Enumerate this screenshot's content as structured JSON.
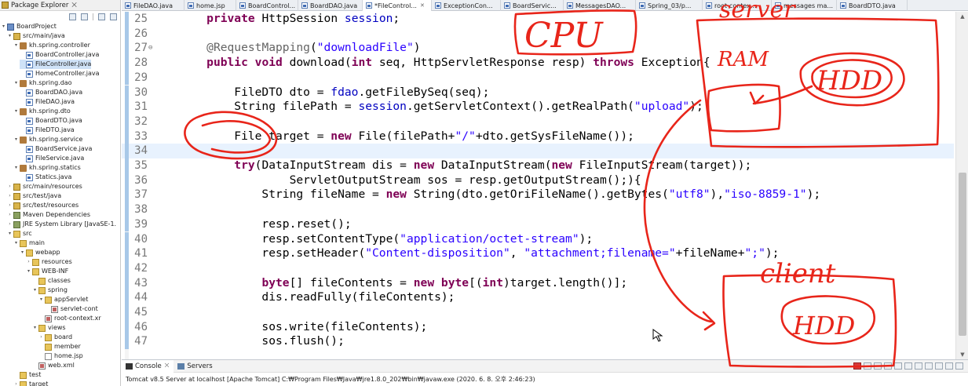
{
  "explorer": {
    "title": "Package Explorer",
    "close_glyph": "⨉",
    "tree": [
      {
        "label": "BoardProject",
        "depth": 0,
        "icon": "project",
        "expanded": true
      },
      {
        "label": "src/main/java",
        "depth": 1,
        "icon": "src",
        "expanded": true
      },
      {
        "label": "kh.spring.controller",
        "depth": 2,
        "icon": "pkg",
        "expanded": true
      },
      {
        "label": "BoardController.java",
        "depth": 3,
        "icon": "java"
      },
      {
        "label": "FileController.java",
        "depth": 3,
        "icon": "java",
        "selected": true
      },
      {
        "label": "HomeController.java",
        "depth": 3,
        "icon": "java"
      },
      {
        "label": "kh.spring.dao",
        "depth": 2,
        "icon": "pkg",
        "expanded": true
      },
      {
        "label": "BoardDAO.java",
        "depth": 3,
        "icon": "java"
      },
      {
        "label": "FileDAO.java",
        "depth": 3,
        "icon": "java"
      },
      {
        "label": "kh.spring.dto",
        "depth": 2,
        "icon": "pkg",
        "expanded": true
      },
      {
        "label": "BoardDTO.java",
        "depth": 3,
        "icon": "java"
      },
      {
        "label": "FileDTO.java",
        "depth": 3,
        "icon": "java"
      },
      {
        "label": "kh.spring.service",
        "depth": 2,
        "icon": "pkg",
        "expanded": true
      },
      {
        "label": "BoardService.java",
        "depth": 3,
        "icon": "java"
      },
      {
        "label": "FileService.java",
        "depth": 3,
        "icon": "java"
      },
      {
        "label": "kh.spring.statics",
        "depth": 2,
        "icon": "pkg",
        "expanded": true
      },
      {
        "label": "Statics.java",
        "depth": 3,
        "icon": "java"
      },
      {
        "label": "src/main/resources",
        "depth": 1,
        "icon": "src",
        "expanded": false
      },
      {
        "label": "src/test/java",
        "depth": 1,
        "icon": "src",
        "expanded": false
      },
      {
        "label": "src/test/resources",
        "depth": 1,
        "icon": "src",
        "expanded": false
      },
      {
        "label": "Maven Dependencies",
        "depth": 1,
        "icon": "lib",
        "expanded": false
      },
      {
        "label": "JRE System Library [JavaSE-1.",
        "depth": 1,
        "icon": "lib",
        "expanded": false
      },
      {
        "label": "src",
        "depth": 1,
        "icon": "folder",
        "expanded": true
      },
      {
        "label": "main",
        "depth": 2,
        "icon": "folder",
        "expanded": true
      },
      {
        "label": "webapp",
        "depth": 3,
        "icon": "folder",
        "expanded": true
      },
      {
        "label": "resources",
        "depth": 4,
        "icon": "folder",
        "expanded": false
      },
      {
        "label": "WEB-INF",
        "depth": 4,
        "icon": "folder",
        "expanded": true
      },
      {
        "label": "classes",
        "depth": 5,
        "icon": "folder"
      },
      {
        "label": "spring",
        "depth": 5,
        "icon": "folder",
        "expanded": true
      },
      {
        "label": "appServlet",
        "depth": 6,
        "icon": "folder",
        "expanded": true
      },
      {
        "label": "servlet-cont",
        "depth": 7,
        "icon": "xml"
      },
      {
        "label": "root-context.xr",
        "depth": 6,
        "icon": "xml"
      },
      {
        "label": "views",
        "depth": 5,
        "icon": "folder",
        "expanded": true
      },
      {
        "label": "board",
        "depth": 6,
        "icon": "folder",
        "expanded": false
      },
      {
        "label": "member",
        "depth": 6,
        "icon": "folder"
      },
      {
        "label": "home.jsp",
        "depth": 6,
        "icon": "file"
      },
      {
        "label": "web.xml",
        "depth": 5,
        "icon": "xml"
      },
      {
        "label": "test",
        "depth": 2,
        "icon": "folder"
      },
      {
        "label": "target",
        "depth": 2,
        "icon": "folder",
        "expanded": false
      }
    ]
  },
  "tabs": [
    {
      "label": "FileDAO.java",
      "active": false
    },
    {
      "label": "home.jsp",
      "active": false
    },
    {
      "label": "BoardControl...",
      "active": false
    },
    {
      "label": "BoardDAO.java",
      "active": false
    },
    {
      "label": "*FileControl...",
      "active": true
    },
    {
      "label": "ExceptionCon...",
      "active": false
    },
    {
      "label": "BoardServic...",
      "active": false
    },
    {
      "label": "MessagesDAO...",
      "active": false
    },
    {
      "label": "Spring_03/p...",
      "active": false
    },
    {
      "label": "root-contex...",
      "active": false
    },
    {
      "label": "messages ma...",
      "active": false
    },
    {
      "label": "BoardDTO.java",
      "active": false
    }
  ],
  "tab_close_glyph": "✕",
  "editor": {
    "current_line": 34,
    "lines": [
      {
        "num": "25",
        "tokens": [
          [
            "    ",
            ""
          ],
          [
            "private",
            "kw"
          ],
          [
            " HttpSession ",
            ""
          ],
          [
            "session",
            "fld"
          ],
          [
            ";",
            ""
          ]
        ]
      },
      {
        "num": "26",
        "tokens": []
      },
      {
        "num": "27",
        "fold": "⊖",
        "tokens": [
          [
            "    ",
            ""
          ],
          [
            "@RequestMapping",
            "ann"
          ],
          [
            "(",
            ""
          ],
          [
            "\"downloadFile\"",
            "str"
          ],
          [
            ")",
            ""
          ]
        ]
      },
      {
        "num": "28",
        "tokens": [
          [
            "    ",
            ""
          ],
          [
            "public",
            "kw"
          ],
          [
            " ",
            ""
          ],
          [
            "void",
            "kw"
          ],
          [
            " download(",
            ""
          ],
          [
            "int",
            "kw"
          ],
          [
            " seq, HttpServletResponse resp) ",
            ""
          ],
          [
            "throws",
            "kw"
          ],
          [
            " Exception{",
            ""
          ]
        ]
      },
      {
        "num": "29",
        "tokens": []
      },
      {
        "num": "30",
        "tokens": [
          [
            "        FileDTO dto = ",
            ""
          ],
          [
            "fdao",
            "fld"
          ],
          [
            ".getFileBySeq(seq);",
            ""
          ]
        ]
      },
      {
        "num": "31",
        "tokens": [
          [
            "        String filePath = ",
            ""
          ],
          [
            "session",
            "fld"
          ],
          [
            ".getServletContext().getRealPath(",
            ""
          ],
          [
            "\"upload\"",
            "str"
          ],
          [
            ");",
            ""
          ]
        ]
      },
      {
        "num": "32",
        "tokens": []
      },
      {
        "num": "33",
        "tokens": [
          [
            "        File target = ",
            ""
          ],
          [
            "new",
            "kw"
          ],
          [
            " File(filePath+",
            ""
          ],
          [
            "\"/\"",
            "str"
          ],
          [
            "+dto.getSysFileName());",
            ""
          ]
        ]
      },
      {
        "num": "34",
        "tokens": []
      },
      {
        "num": "35",
        "tokens": [
          [
            "        ",
            ""
          ],
          [
            "try",
            "kw"
          ],
          [
            "(DataInputStream dis = ",
            ""
          ],
          [
            "new",
            "kw"
          ],
          [
            " DataInputStream(",
            ""
          ],
          [
            "new",
            "kw"
          ],
          [
            " FileInputStream(target));",
            ""
          ]
        ]
      },
      {
        "num": "36",
        "tokens": [
          [
            "                ServletOutputStream sos = resp.getOutputStream();){",
            ""
          ]
        ]
      },
      {
        "num": "37",
        "tokens": [
          [
            "            String fileName = ",
            ""
          ],
          [
            "new",
            "kw"
          ],
          [
            " String(dto.getOriFileName().getBytes(",
            ""
          ],
          [
            "\"utf8\"",
            "str"
          ],
          [
            "),",
            ""
          ],
          [
            "\"iso-8859-1\"",
            "str"
          ],
          [
            ");",
            ""
          ]
        ]
      },
      {
        "num": "38",
        "tokens": []
      },
      {
        "num": "39",
        "tokens": [
          [
            "            resp.reset();",
            ""
          ]
        ]
      },
      {
        "num": "40",
        "tokens": [
          [
            "            resp.setContentType(",
            ""
          ],
          [
            "\"application/octet-stream\"",
            "str"
          ],
          [
            ");",
            ""
          ]
        ]
      },
      {
        "num": "41",
        "tokens": [
          [
            "            resp.setHeader(",
            ""
          ],
          [
            "\"Content-disposition\"",
            "str"
          ],
          [
            ", ",
            ""
          ],
          [
            "\"attachment;filename=\"",
            "str"
          ],
          [
            "+fileName+",
            ""
          ],
          [
            "\";\"",
            "str"
          ],
          [
            ");",
            ""
          ]
        ]
      },
      {
        "num": "42",
        "tokens": []
      },
      {
        "num": "43",
        "tokens": [
          [
            "            ",
            ""
          ],
          [
            "byte",
            "kw"
          ],
          [
            "[] fileContents = ",
            ""
          ],
          [
            "new",
            "kw"
          ],
          [
            " ",
            ""
          ],
          [
            "byte",
            "kw"
          ],
          [
            "[(",
            ""
          ],
          [
            "int",
            "kw"
          ],
          [
            ")target.length()];",
            ""
          ]
        ]
      },
      {
        "num": "44",
        "tokens": [
          [
            "            dis.readFully(fileContents);",
            ""
          ]
        ]
      },
      {
        "num": "45",
        "tokens": []
      },
      {
        "num": "46",
        "tokens": [
          [
            "            sos.write(fileContents);",
            ""
          ]
        ]
      },
      {
        "num": "47",
        "tokens": [
          [
            "            sos.flush();",
            ""
          ]
        ]
      }
    ]
  },
  "console": {
    "tab_console": "Console",
    "tab_console_x": "⨉",
    "tab_servers": "Servers",
    "status": "Tomcat v8.5 Server at localhost [Apache Tomcat] C:₩Program Files₩Java₩jre1.8.0_202₩bin₩javaw.exe (2020. 6. 8. 오후 2:46:23)"
  },
  "annotations": {
    "cpu": "CPU",
    "server": "server",
    "ram": "RAM",
    "hdd_server": "HDD",
    "client": "client",
    "hdd_client": "HDD",
    "ink_color": "#e8251a"
  },
  "colors": {
    "keyword": "#7f0055",
    "string": "#2a00ff",
    "field": "#0000c0",
    "annotation": "#646464",
    "current_line": "#e8f2fe",
    "selection": "#cfe2f7"
  }
}
